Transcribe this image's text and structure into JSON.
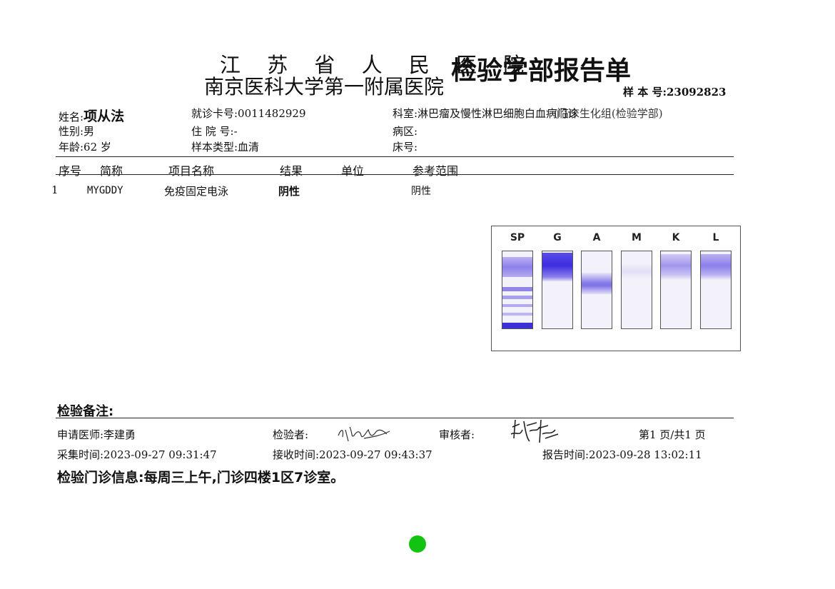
{
  "header": {
    "hospital_line1": "江 苏 省 人 民 医 院",
    "hospital_line2": "南京医科大学第一附属医院",
    "report_title": "检验学部报告单",
    "sample_no_label": "样 本 号:",
    "sample_no": "23092823"
  },
  "patient": {
    "name_label": "姓名:",
    "name": "项从法",
    "gender": "性别:男",
    "age": "年龄:62  岁",
    "card_no": "就诊卡号:0011482929",
    "inpatient_no": "住 院 号:-",
    "sample_type": "样本类型:血清",
    "department": "科室:淋巴瘤及慢性淋巴细胞白血病门诊",
    "department_overlap": "(临床生化组(检验学部)",
    "ward": "病区:",
    "bed": "床号:"
  },
  "table": {
    "headers": [
      "序号",
      "简称",
      "项目名称",
      "结果",
      "单位",
      "参考范围"
    ],
    "rows": [
      {
        "no": "1",
        "abbr": "MYGDDY",
        "name": "免疫固定电泳",
        "result": "阴性",
        "unit": "",
        "range": "阴性"
      }
    ]
  },
  "gel": {
    "lanes": [
      "SP",
      "G",
      "A",
      "M",
      "K",
      "L"
    ]
  },
  "footer": {
    "remark_label": "检验备注:",
    "doctor": "申请医师:李建勇",
    "examiner_label": "检验者:",
    "reviewer_label": "审核者:",
    "page": "第1 页/共1  页",
    "collect_time": "采集时间:2023-09-27 09:31:47",
    "receive_time": "接收时间:2023-09-27 09:43:37",
    "report_time": "报告时间:2023-09-28 13:02:11",
    "clinic_info": "检验门诊信息:每周三上午,门诊四楼1区7诊室。"
  },
  "colors": {
    "band_purple": "#5b4ee0",
    "status_dot": "#12c312"
  }
}
